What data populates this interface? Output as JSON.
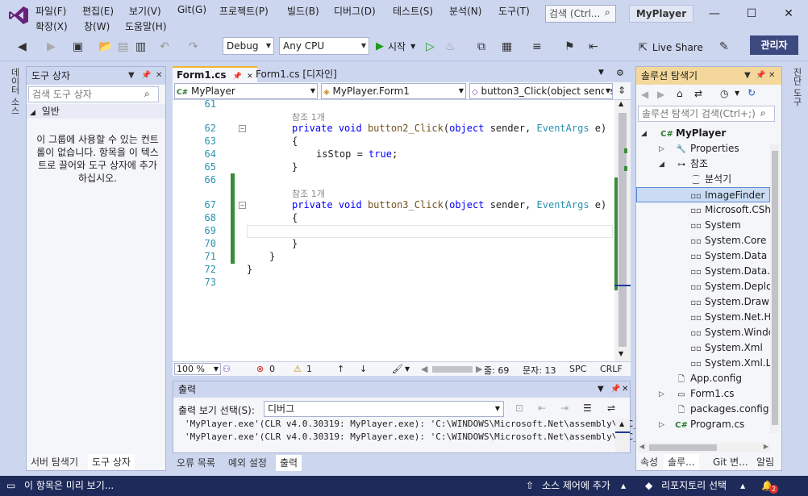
{
  "menu": {
    "file": "파일(F)",
    "edit": "편집(E)",
    "view": "보기(V)",
    "git": "Git(G)",
    "project": "프로젝트(P)",
    "build": "빌드(B)",
    "debug": "디버그(D)",
    "test": "테스트(S)",
    "analyze": "분석(N)",
    "tools": "도구(T)",
    "extensions": "확장(X)",
    "window": "창(W)",
    "help": "도움말(H)"
  },
  "search": {
    "placeholder": "검색 (Ctrl..."
  },
  "app_title": "MyPlayer",
  "toolbar": {
    "config": "Debug",
    "platform": "Any CPU",
    "start_label": "시작",
    "live_share": "Live Share",
    "admin_label": "관리자"
  },
  "left_vtabs": {
    "data_sources": "데이터 소스"
  },
  "toolbox": {
    "title": "도구 상자",
    "search_placeholder": "검색 도구 상자",
    "group": "일반",
    "empty_message": "이 그룹에 사용할 수 있는 컨트롤이 없습니다. 항목을 이 텍스트로 끌어와 도구 상자에 추가하십시오.",
    "tab_server": "서버 탐색기",
    "tab_toolbox": "도구 상자"
  },
  "editor": {
    "tab_code": "Form1.cs",
    "tab_designer": "Form1.cs [디자인]",
    "nav_project": "MyPlayer",
    "nav_class": "MyPlayer.Form1",
    "nav_member": "button3_Click(object sende",
    "ref_label": "참조 1개",
    "lines": {
      "l61": "61",
      "l62": "62",
      "l63": "63",
      "l64": "64",
      "l65": "65",
      "l66": "66",
      "l67": "67",
      "l68": "68",
      "l69": "69",
      "l70": "70",
      "l71": "71",
      "l72": "72",
      "l73": "73"
    },
    "code": {
      "kw_private": "private",
      "kw_void": "void",
      "m2": "button2_Click",
      "m3": "button3_Click",
      "kw_object": "object",
      "p_sender": "sender,",
      "t_eventargs": "EventArgs",
      "p_e": "e)",
      "open_brace": "{",
      "close_brace": "}",
      "stmt_var": "isStop = ",
      "kw_true": "true",
      "semi": ";"
    },
    "status": {
      "zoom": "100 %",
      "errors": "0",
      "warnings": "1",
      "line": "줄: 69",
      "col": "문자: 13",
      "spc": "SPC",
      "crlf": "CRLF"
    }
  },
  "output": {
    "title": "출력",
    "source_label": "출력 보기 선택(S):",
    "source_value": "디버그",
    "lines": [
      "'MyPlayer.exe'(CLR v4.0.30319: MyPlayer.exe): 'C:\\WINDOWS\\Microsoft.Net\\assembly\\GAC_MSIL",
      "'MyPlayer.exe'(CLR v4.0.30319: MyPlayer.exe): 'C:\\WINDOWS\\Microsoft.Net\\assembly\\GAC_MSIL"
    ],
    "tab_errors": "오류 목록",
    "tab_exceptions": "예외 설정",
    "tab_output": "출력"
  },
  "solution": {
    "title": "솔루션 탐색기",
    "search_placeholder": "솔루션 탐색기 검색(Ctrl+;)",
    "items": [
      "MyPlayer",
      "Properties",
      "참조",
      "분석기",
      "ImageFinder",
      "Microsoft.CSh",
      "System",
      "System.Core",
      "System.Data",
      "System.Data.D",
      "System.Deplo",
      "System.Drawi",
      "System.Net.H",
      "System.Windo",
      "System.Xml",
      "System.Xml.Li",
      "App.config",
      "Form1.cs",
      "packages.config",
      "Program.cs"
    ],
    "tab_properties": "속성",
    "tab_solution": "솔루...",
    "tab_git": "Git 변...",
    "tab_notifications": "알림"
  },
  "right_vtabs": {
    "toolbox": "진단 도구"
  },
  "statusbar": {
    "message": "이 항목은 미리 보기...",
    "source_control": "소스 제어에 추가",
    "repository": "리포지토리 선택",
    "notifications": "2"
  },
  "colors": {
    "accent": "#68217a",
    "statusbar": "#1e2a59",
    "keyword": "#0000ff",
    "type": "#2b91af"
  }
}
